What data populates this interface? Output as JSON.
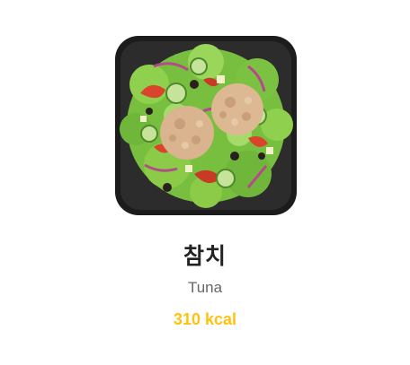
{
  "product": {
    "name_ko": "참치",
    "name_en": "Tuna",
    "calories": "310 kcal",
    "image_icon": "tuna-salad-bowl-image"
  },
  "colors": {
    "background": "#ffffff",
    "title": "#222222",
    "subtitle": "#666666",
    "calories": "#ffc20e",
    "bowl": "#1c1c1c",
    "lettuce": "#7cc242",
    "tuna": "#d9b48f",
    "tomato": "#d9442b",
    "cucumber": "#c6e39a",
    "onion": "#b54a8a",
    "olive": "#2a1f1f"
  }
}
